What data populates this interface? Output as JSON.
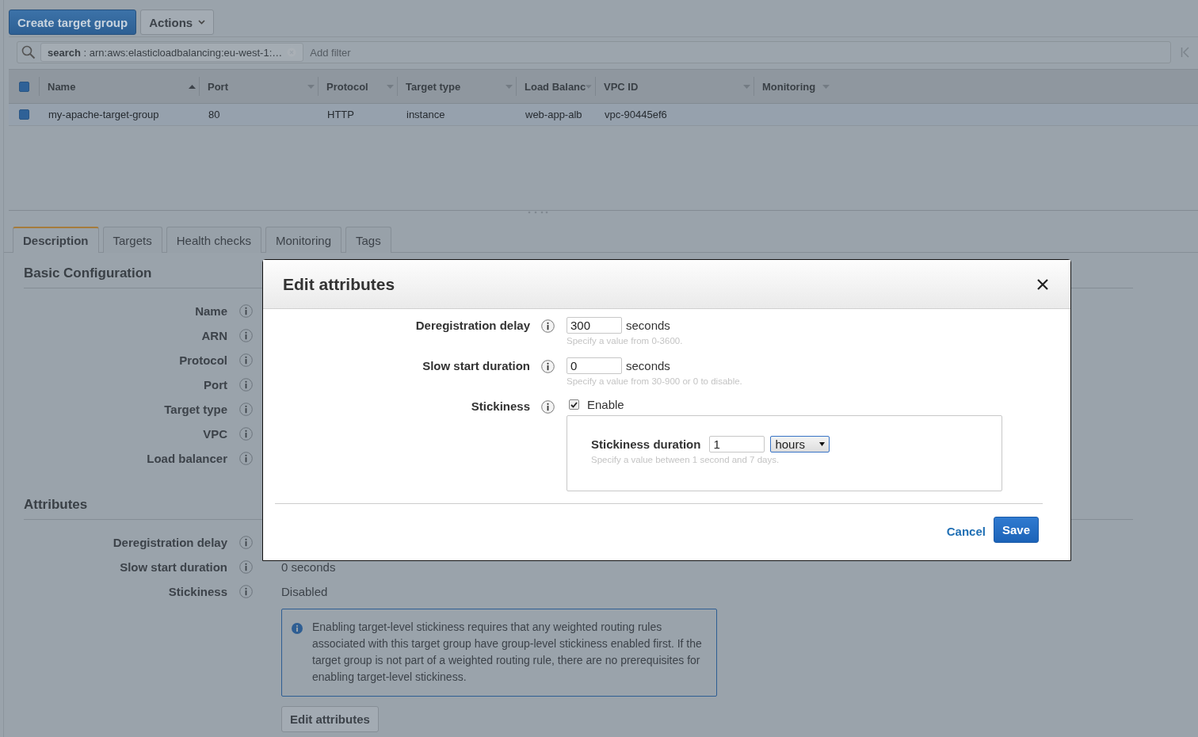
{
  "toolbar": {
    "create_button": "Create target group",
    "actions_button": "Actions"
  },
  "filter": {
    "token": "**search** : arn:aws:elasticloadbalancing:eu-west-1:…",
    "placeholder": "Add filter"
  },
  "table": {
    "all_selected": true,
    "columns": [
      {
        "label": "Name",
        "sorted": true
      },
      {
        "label": "Port",
        "sorted": false
      },
      {
        "label": "Protocol",
        "sorted": false
      },
      {
        "label": "Target type",
        "sorted": false
      },
      {
        "label": "Load Balanc",
        "sorted": false
      },
      {
        "label": "VPC ID",
        "sorted": false
      },
      {
        "label": "Monitoring",
        "sorted": false
      }
    ],
    "rows": [
      {
        "selected": true,
        "cells": [
          "my-apache-target-group",
          "80",
          "HTTP",
          "instance",
          "web-app-alb",
          "vpc-90445ef6",
          ""
        ]
      }
    ]
  },
  "tabs": [
    {
      "label": "Description",
      "selected": true
    },
    {
      "label": "Targets",
      "selected": false
    },
    {
      "label": "Health checks",
      "selected": false
    },
    {
      "label": "Monitoring",
      "selected": false
    },
    {
      "label": "Tags",
      "selected": false
    }
  ],
  "basic_configuration": {
    "title": "Basic Configuration",
    "fields": [
      {
        "label": "Name"
      },
      {
        "label": "ARN"
      },
      {
        "label": "Protocol"
      },
      {
        "label": "Port"
      },
      {
        "label": "Target type"
      },
      {
        "label": "VPC"
      },
      {
        "label": "Load balancer"
      }
    ]
  },
  "attributes": {
    "title": "Attributes",
    "fields": [
      {
        "label": "Deregistration delay"
      },
      {
        "label": "Slow start duration",
        "value": "0 seconds"
      },
      {
        "label": "Stickiness",
        "value": "Disabled"
      }
    ]
  },
  "info_note": "Enabling target-level stickiness requires that any weighted routing rules associated with this target group have group-level stickiness enabled first. If the target group is not part of a weighted routing rule, there are no prerequisites for enabling target-level stickiness.",
  "edit_button": "Edit attributes",
  "modal": {
    "title": "Edit attributes",
    "fields": [
      {
        "kind": "number",
        "label": "Deregistration delay",
        "value": "300",
        "unit": "seconds",
        "hint": "Specify a value from 0-3600."
      },
      {
        "kind": "number",
        "label": "Slow start duration",
        "value": "0",
        "unit": "seconds",
        "hint": "Specify a value from 30-900 or 0 to disable."
      },
      {
        "kind": "checkbox",
        "label": "Stickiness",
        "checked": true,
        "option_label": "Enable",
        "sub": {
          "label": "Stickiness duration",
          "value": "1",
          "unit": "hours",
          "hint": "Specify a value between 1 second and 7 days."
        }
      }
    ],
    "cancel": "Cancel",
    "save": "Save"
  }
}
